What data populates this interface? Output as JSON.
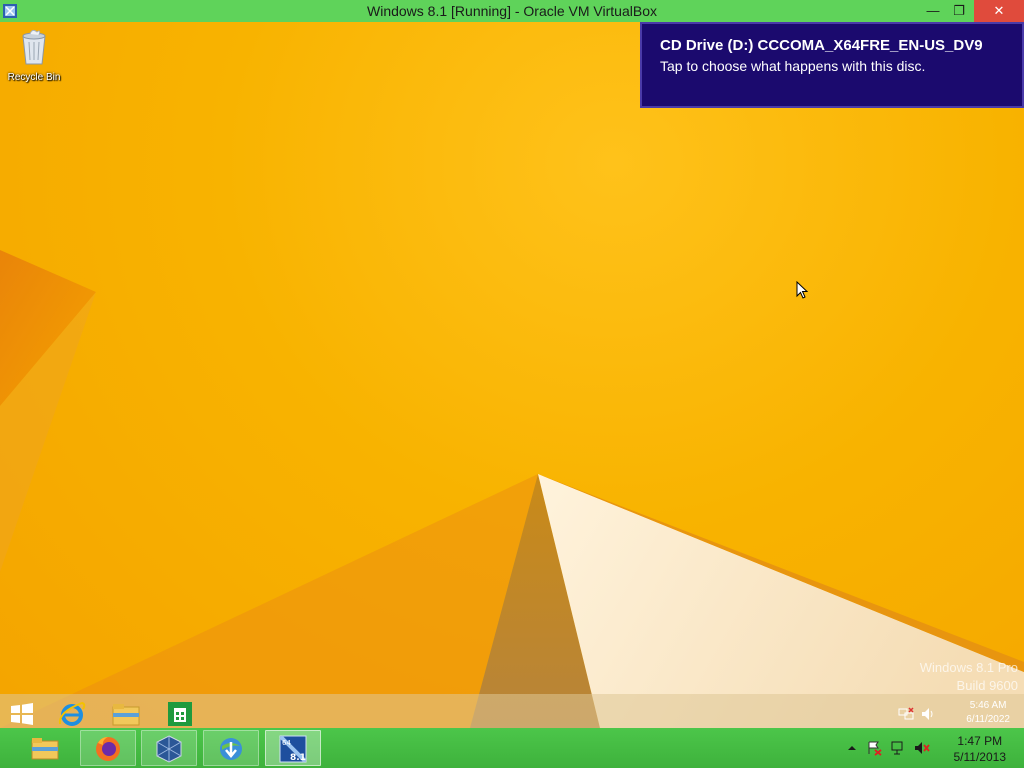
{
  "host_window": {
    "title": "Windows 8.1 [Running] - Oracle VM VirtualBox",
    "minimize_glyph": "—",
    "restore_glyph": "❐",
    "close_glyph": "✕"
  },
  "desktop": {
    "icons": [
      {
        "label": "Recycle Bin",
        "icon": "recycle-bin-icon"
      }
    ],
    "watermark": {
      "line1": "Windows 8.1 Pro",
      "line2": "Build 9600"
    }
  },
  "notification": {
    "title": "CD Drive (D:) CCCOMA_X64FRE_EN-US_DV9",
    "message": "Tap to choose what happens with this disc."
  },
  "guest_taskbar": {
    "items": [
      "start-icon",
      "internet-explorer-icon",
      "file-explorer-icon",
      "store-icon"
    ],
    "clock": {
      "time": "5:46 AM",
      "date": "6/11/2022"
    }
  },
  "host_taskbar": {
    "items": [
      "file-explorer-icon",
      "firefox-icon",
      "virtualbox-icon",
      "internet-download-manager-icon",
      "windows-8-1-vm-icon"
    ],
    "vm_badge": {
      "top": "64",
      "bottom": "8.1"
    },
    "clock": {
      "time": "1:47 PM",
      "date": "5/11/2013"
    }
  },
  "colors": {
    "host_green": "#4cc64a",
    "desktop_yellow": "#f8b300",
    "toast_bg": "#1b0a6e"
  }
}
